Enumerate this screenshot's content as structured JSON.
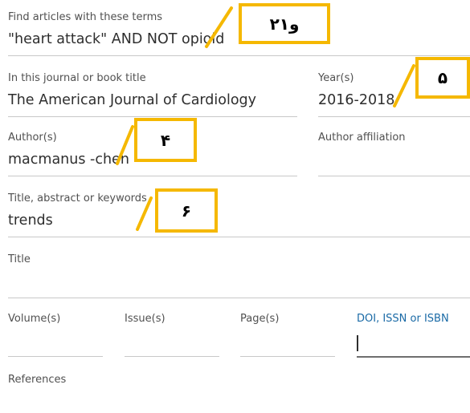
{
  "form": {
    "terms": {
      "label": "Find articles with these terms",
      "value": "\"heart attack\" AND NOT opioid"
    },
    "journal": {
      "label": "In this journal or book title",
      "value": "The American Journal of Cardiology"
    },
    "years": {
      "label": "Year(s)",
      "value": "2016-2018"
    },
    "authors": {
      "label": "Author(s)",
      "value": "macmanus -chen"
    },
    "affiliation": {
      "label": "Author affiliation",
      "value": ""
    },
    "keywords": {
      "label": "Title, abstract or keywords",
      "value": "trends"
    },
    "title": {
      "label": "Title",
      "value": ""
    },
    "volume": {
      "label": "Volume(s)",
      "value": ""
    },
    "issue": {
      "label": "Issue(s)",
      "value": ""
    },
    "pages": {
      "label": "Page(s)",
      "value": ""
    },
    "doi": {
      "label": "DOI, ISSN or ISBN",
      "value": ""
    },
    "references": {
      "label": "References",
      "value": ""
    }
  },
  "annotations": {
    "a12": "۲و۱",
    "a5": "۵",
    "a4": "۴",
    "a6": "۶"
  },
  "colors": {
    "annotation": "#f5b800",
    "link": "#1a6aa6"
  }
}
